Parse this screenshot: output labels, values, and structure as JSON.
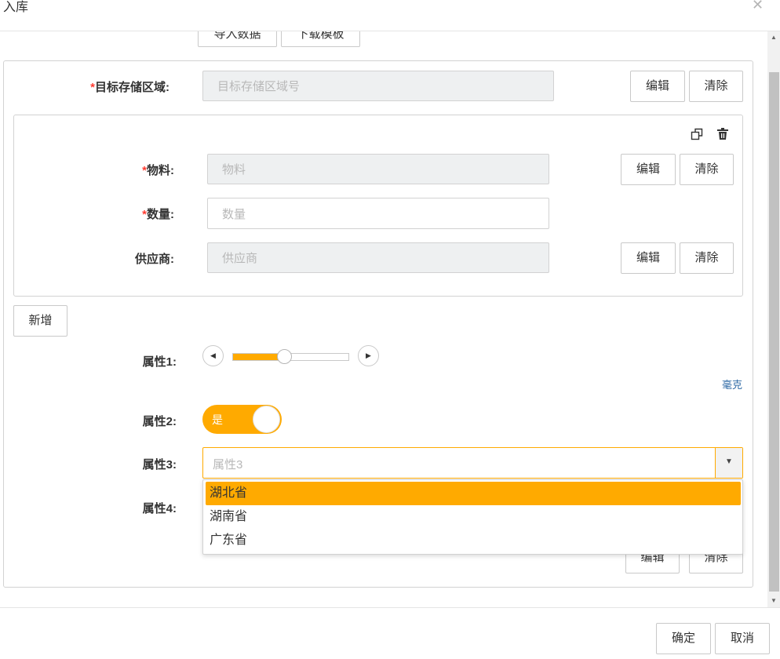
{
  "dialog": {
    "title": "入库"
  },
  "top_buttons": {
    "import_label": "导入数据",
    "template_label": "下载模板"
  },
  "target_area": {
    "label": "目标存储区域:",
    "placeholder": "目标存储区域号",
    "edit_label": "编辑",
    "clear_label": "清除"
  },
  "item_group": {
    "material": {
      "label": "物料:",
      "placeholder": "物料",
      "edit_label": "编辑",
      "clear_label": "清除"
    },
    "quantity": {
      "label": "数量:",
      "placeholder": "数量"
    },
    "supplier": {
      "label": "供应商:",
      "placeholder": "供应商",
      "edit_label": "编辑",
      "clear_label": "清除"
    }
  },
  "add_button_label": "新增",
  "attr1": {
    "label": "属性1:",
    "unit": "毫克",
    "slider_fraction": 0.44
  },
  "attr2": {
    "label": "属性2:",
    "toggle_text": "是",
    "toggle_on": true
  },
  "attr3": {
    "label": "属性3:",
    "placeholder": "属性3",
    "options": [
      "湖北省",
      "湖南省",
      "广东省"
    ],
    "highlighted_index": 0
  },
  "attr4": {
    "label": "属性4:",
    "edit_label": "编辑",
    "clear_label": "清除"
  },
  "footer": {
    "confirm_label": "确定",
    "cancel_label": "取消"
  },
  "colors": {
    "accent": "#ffaa00",
    "required": "#ff3b30",
    "disabled_bg": "#eef0f1",
    "border": "#d2d2d2"
  }
}
